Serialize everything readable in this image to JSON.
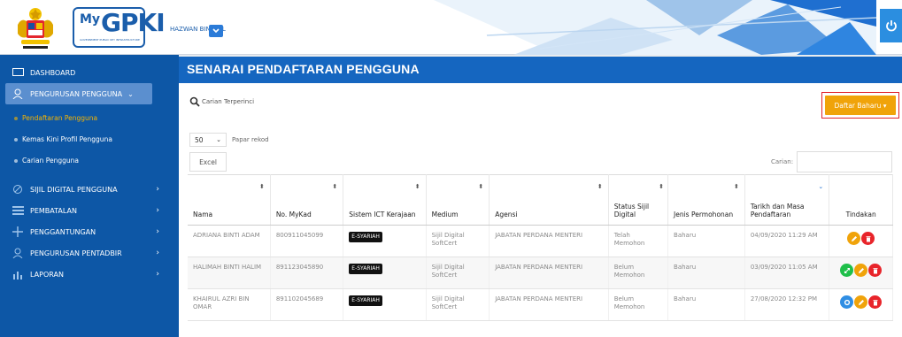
{
  "header": {
    "user_name": "HAZWAN BIN DOL",
    "logo_text_my": "My",
    "logo_text_pki": "GPKI",
    "logo_sub": "GOVERNMENT PUBLIC KEY INFRASTRUCTURE"
  },
  "sidebar": {
    "items": [
      {
        "label": "DASHBOARD",
        "icon": "monitor-icon"
      },
      {
        "label": "PENGURUSAN PENGGUNA",
        "icon": "user-icon",
        "active": true
      },
      {
        "label": "SIJIL DIGITAL PENGGUNA",
        "icon": "certificate-icon"
      },
      {
        "label": "PEMBATALAN",
        "icon": "list-icon"
      },
      {
        "label": "PENGGANTUNGAN",
        "icon": "move-icon"
      },
      {
        "label": "PENGURUSAN PENTADBIR",
        "icon": "admin-icon"
      },
      {
        "label": "LAPORAN",
        "icon": "bar-chart-icon"
      }
    ],
    "sub_items": [
      {
        "label": "Pendaftaran Pengguna",
        "current": true
      },
      {
        "label": "Kemas Kini Profil Pengguna"
      },
      {
        "label": "Carian Pengguna"
      }
    ]
  },
  "main": {
    "title": "SENARAI PENDAFTARAN PENGGUNA",
    "advanced_search": "Carian Terperinci",
    "register_button": "Daftar Baharu ▾",
    "page_size": "50",
    "page_size_label": "Papar rekod",
    "excel_button": "Excel",
    "search_label": "Carian:",
    "search_value": ""
  },
  "table": {
    "headers": [
      "Nama",
      "No. MyKad",
      "Sistem ICT Kerajaan",
      "Medium",
      "Agensi",
      "Status Sijil Digital",
      "Jenis Permohonan",
      "Tarikh dan Masa Pendaftaran",
      "Tindakan"
    ],
    "rows": [
      {
        "nama": "ADRIANA BINTI ADAM",
        "mykad": "800911045099",
        "sistem": "E-SYARIAH",
        "medium": "Sijil Digital SoftCert",
        "agensi": "JABATAN PERDANA MENTERI",
        "status": "Telah Memohon",
        "jenis": "Baharu",
        "tarikh": "04/09/2020 11:29 AM",
        "actions": [
          "edit",
          "delete"
        ]
      },
      {
        "nama": "HALIMAH BINTI HALIM",
        "mykad": "891123045890",
        "sistem": "E-SYARIAH",
        "medium": "Sijil Digital SoftCert",
        "agensi": "JABATAN PERDANA MENTERI",
        "status": "Belum Memohon",
        "jenis": "Baharu",
        "tarikh": "03/09/2020 11:05 AM",
        "actions": [
          "apply",
          "edit",
          "delete"
        ]
      },
      {
        "nama": "KHAIRUL AZRI BIN OMAR",
        "mykad": "891102045689",
        "sistem": "E-SYARIAH",
        "medium": "Sijil Digital SoftCert",
        "agensi": "JABATAN PERDANA MENTERI",
        "status": "Belum Memohon",
        "jenis": "Baharu",
        "tarikh": "27/08/2020 12:32 PM",
        "actions": [
          "settings",
          "edit",
          "delete"
        ]
      }
    ]
  },
  "colors": {
    "sidebar": "#0d57a6",
    "title_bar": "#1566c0",
    "accent_orange": "#f0a30a",
    "danger": "#e8242a",
    "success": "#1fbf4a"
  }
}
